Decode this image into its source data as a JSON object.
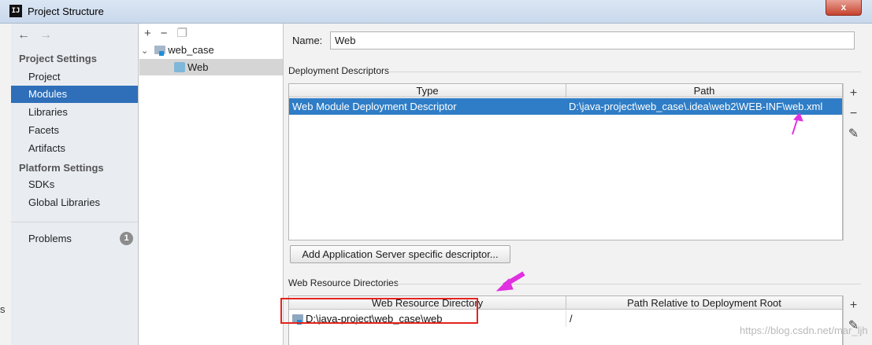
{
  "window": {
    "app_icon": "IJ",
    "title": "Project Structure",
    "close_label": "x"
  },
  "nav": {
    "back_icon": "←",
    "forward_icon": "→",
    "project_settings_heading": "Project Settings",
    "project_settings_items": [
      "Project",
      "Modules",
      "Libraries",
      "Facets",
      "Artifacts"
    ],
    "selected_item": "Modules",
    "platform_settings_heading": "Platform Settings",
    "platform_settings_items": [
      "SDKs",
      "Global Libraries"
    ],
    "problems_label": "Problems",
    "problems_count": "1"
  },
  "tree": {
    "add_icon": "+",
    "remove_icon": "−",
    "copy_icon": "❐",
    "root_arrow": "⌄",
    "root_label": "web_case",
    "child_label": "Web"
  },
  "facet": {
    "name_label": "Name:",
    "name_value": "Web",
    "deployment_descriptors_label": "Deployment Descriptors",
    "dd_columns": [
      "Type",
      "Path"
    ],
    "dd_rows": [
      {
        "type": "Web Module Deployment Descriptor",
        "path": "D:\\java-project\\web_case\\.idea\\web2\\WEB-INF\\web.xml"
      }
    ],
    "add_descriptor_button": "Add Application Server specific descriptor...",
    "web_resource_label": "Web Resource Directories",
    "wr_columns": [
      "Web Resource Directory",
      "Path Relative to Deployment Root"
    ],
    "wr_rows": [
      {
        "directory": "D:\\java-project\\web_case\\web",
        "relative_path": "/"
      }
    ],
    "add_icon": "+",
    "remove_icon": "−",
    "edit_icon": "✎"
  },
  "annotations": {
    "arrow_color": "#e030e0",
    "box_color": "#e4241c"
  },
  "watermark": "https://blog.csdn.net/mar_ljh",
  "edge_char": "s"
}
